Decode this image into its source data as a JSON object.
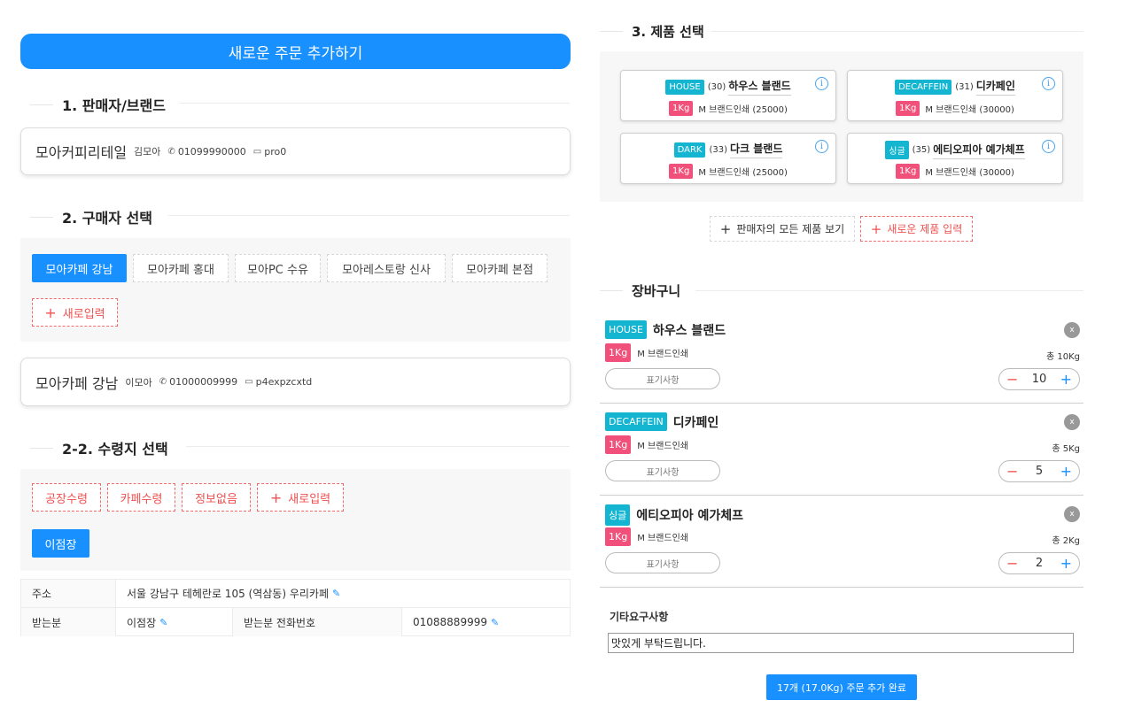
{
  "header": {
    "title": "새로운 주문 추가하기"
  },
  "seller": {
    "section_title": "1. 판매자/브랜드",
    "name": "모아커피리테일",
    "person": "김모아",
    "phone": "01099990000",
    "id": "pro0"
  },
  "buyer": {
    "section_title": "2. 구매자 선택",
    "options": [
      "모아카페 강남",
      "모아카페 홍대",
      "모아PC 수유",
      "모아레스토랑 신사",
      "모아카페 본점"
    ],
    "selected": "모아카페 강남",
    "new_label": "새로입력",
    "card": {
      "name": "모아카페 강남",
      "person": "이모아",
      "phone": "01000009999",
      "id": "p4expzcxtd"
    }
  },
  "receiver": {
    "section_title": "2-2. 수령지 선택",
    "options": [
      "공장수령",
      "카페수령",
      "정보없음"
    ],
    "new_label": "새로입력",
    "selected_button": "이점장",
    "address_label": "주소",
    "address_value": "서울 강남구 테헤란로 105 (역삼동) 우리카페",
    "recipient_label": "받는분",
    "recipient_value": "이점장",
    "recipient_phone_label": "받는분 전화번호",
    "recipient_phone_value": "01088889999"
  },
  "products": {
    "section_title": "3. 제품 선택",
    "items": [
      {
        "tag": "HOUSE",
        "num": "(30)",
        "name": "하우스 블랜드",
        "size": "1Kg",
        "desc": "M 브랜드인쇄 (25000)"
      },
      {
        "tag": "DECAFFEIN",
        "num": "(31)",
        "name": "디카페인",
        "size": "1Kg",
        "desc": "M 브랜드인쇄 (30000)"
      },
      {
        "tag": "DARK",
        "num": "(33)",
        "name": "다크 블랜드",
        "size": "1Kg",
        "desc": "M 브랜드인쇄 (25000)"
      },
      {
        "tag": "싱글",
        "num": "(35)",
        "name": "에티오피아 예가체프",
        "size": "1Kg",
        "desc": "M 브랜드인쇄 (30000)"
      }
    ],
    "view_all_label": "판매자의 모든 제품 보기",
    "new_product_label": "새로운 제품 입력"
  },
  "cart": {
    "section_title": "장바구니",
    "items": [
      {
        "tag": "HOUSE",
        "name": "하우스 블랜드",
        "size": "1Kg",
        "desc": "M 브랜드인쇄",
        "weight": "총 10Kg",
        "memo": "표기사항",
        "qty": "10"
      },
      {
        "tag": "DECAFFEIN",
        "name": "디카페인",
        "size": "1Kg",
        "desc": "M 브랜드인쇄",
        "weight": "총 5Kg",
        "memo": "표기사항",
        "qty": "5"
      },
      {
        "tag": "싱글",
        "name": "에티오피아 예가체프",
        "size": "1Kg",
        "desc": "M 브랜드인쇄",
        "weight": "총 2Kg",
        "memo": "표기사항",
        "qty": "2"
      }
    ],
    "remove_glyph": "x"
  },
  "request": {
    "label": "기타요구사항",
    "value": "맛있게 부탁드립니다."
  },
  "submit": {
    "label": "17개 (17.0Kg) 주문 추가 완료"
  },
  "colors": {
    "primary": "#1890ff",
    "danger": "#f05050",
    "tag_cyan": "#13b5d1",
    "tag_pink": "#f0507a"
  }
}
